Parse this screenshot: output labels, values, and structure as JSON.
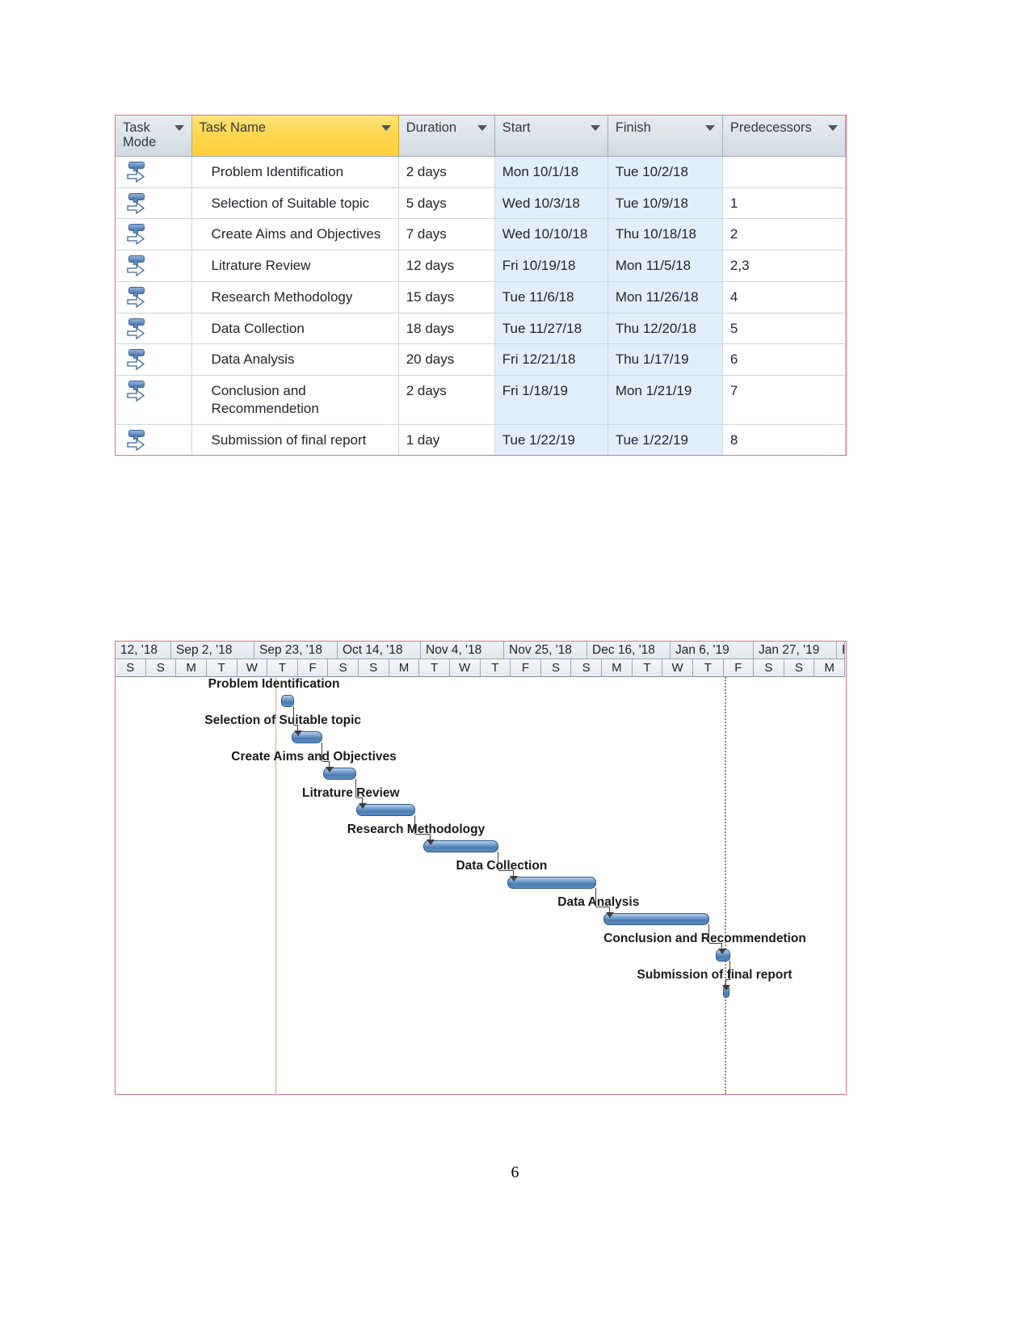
{
  "document": {
    "page_number": "6"
  },
  "task_table": {
    "columns": [
      {
        "key": "mode",
        "label": "Task Mode",
        "highlight": false,
        "has_filter_arrow": true
      },
      {
        "key": "name",
        "label": "Task Name",
        "highlight": true,
        "has_filter_arrow": true
      },
      {
        "key": "duration",
        "label": "Duration",
        "highlight": false,
        "has_filter_arrow": true
      },
      {
        "key": "start",
        "label": "Start",
        "highlight": false,
        "has_filter_arrow": true
      },
      {
        "key": "finish",
        "label": "Finish",
        "highlight": false,
        "has_filter_arrow": true
      },
      {
        "key": "predecessors",
        "label": "Predecessors",
        "highlight": false,
        "has_filter_arrow": true
      }
    ],
    "rows": [
      {
        "id": 1,
        "mode_icon": "auto-schedule-icon",
        "name": "Problem Identification",
        "duration": "2 days",
        "start": "Mon 10/1/18",
        "finish": "Tue 10/2/18",
        "predecessors": ""
      },
      {
        "id": 2,
        "mode_icon": "auto-schedule-icon",
        "name": "Selection of Suitable topic",
        "duration": "5 days",
        "start": "Wed 10/3/18",
        "finish": "Tue 10/9/18",
        "predecessors": "1"
      },
      {
        "id": 3,
        "mode_icon": "auto-schedule-icon",
        "name": "Create Aims and Objectives",
        "duration": "7 days",
        "start": "Wed 10/10/18",
        "finish": "Thu 10/18/18",
        "predecessors": "2"
      },
      {
        "id": 4,
        "mode_icon": "auto-schedule-icon",
        "name": "Litrature Review",
        "duration": "12 days",
        "start": "Fri 10/19/18",
        "finish": "Mon 11/5/18",
        "predecessors": "2,3"
      },
      {
        "id": 5,
        "mode_icon": "auto-schedule-icon",
        "name": "Research Methodology",
        "duration": "15 days",
        "start": "Tue 11/6/18",
        "finish": "Mon 11/26/18",
        "predecessors": "4"
      },
      {
        "id": 6,
        "mode_icon": "auto-schedule-icon",
        "name": "Data Collection",
        "duration": "18 days",
        "start": "Tue 11/27/18",
        "finish": "Thu 12/20/18",
        "predecessors": "5"
      },
      {
        "id": 7,
        "mode_icon": "auto-schedule-icon",
        "name": "Data Analysis",
        "duration": "20 days",
        "start": "Fri 12/21/18",
        "finish": "Thu 1/17/19",
        "predecessors": "6"
      },
      {
        "id": 8,
        "mode_icon": "auto-schedule-icon",
        "name": "Conclusion and Recommendetion",
        "duration": "2 days",
        "start": "Fri 1/18/19",
        "finish": "Mon 1/21/19",
        "predecessors": "7"
      },
      {
        "id": 9,
        "mode_icon": "auto-schedule-icon",
        "name": "Submission of final report",
        "duration": "1 day",
        "start": "Tue 1/22/19",
        "finish": "Tue 1/22/19",
        "predecessors": "8"
      }
    ]
  },
  "gantt": {
    "timeline": {
      "week_labels": [
        "12, '18",
        "Sep 2, '18",
        "Sep 23, '18",
        "Oct 14, '18",
        "Nov 4, '18",
        "Nov 25, '18",
        "Dec 16, '18",
        "Jan 6, '19",
        "Jan 27, '19",
        "Feb"
      ],
      "day_labels": [
        "S",
        "S",
        "M",
        "T",
        "W",
        "T",
        "F",
        "S",
        "S",
        "M",
        "T",
        "W",
        "T",
        "F",
        "S",
        "S",
        "M",
        "T",
        "W",
        "T",
        "F",
        "S",
        "S",
        "M"
      ]
    },
    "bars": [
      {
        "task": "Problem Identification",
        "label": "Problem Identification",
        "left_pct": 22.7,
        "width_pct": 1.7,
        "row": 0
      },
      {
        "task": "Selection of Suitable topic",
        "label": "Selection of Suitable topic",
        "left_pct": 24.1,
        "width_pct": 4.2,
        "row": 1
      },
      {
        "task": "Create Aims and Objectives",
        "label": "Create Aims and Objectives",
        "left_pct": 28.4,
        "width_pct": 4.6,
        "row": 2
      },
      {
        "task": "Litrature Review",
        "label": "Litrature Review",
        "left_pct": 33.0,
        "width_pct": 8.0,
        "row": 3
      },
      {
        "task": "Research Methodology",
        "label": "Research Methodology",
        "left_pct": 42.2,
        "width_pct": 10.2,
        "row": 4
      },
      {
        "task": "Data Collection",
        "label": "Data Collection",
        "left_pct": 53.6,
        "width_pct": 12.2,
        "row": 5
      },
      {
        "task": "Data Analysis",
        "label": "Data Analysis",
        "left_pct": 66.8,
        "width_pct": 14.5,
        "row": 6
      },
      {
        "task": "Conclusion and Recommendetion",
        "label": "Conclusion and Recommendetion",
        "left_pct": 82.2,
        "width_pct": 2.0,
        "row": 7
      },
      {
        "task": "Submission of final report",
        "label": "Submission of final report",
        "left_pct": 83.2,
        "width_pct": 0.9,
        "row": 8
      }
    ],
    "markers": {
      "project_start_line_pct": 21.9,
      "status_line_pct": 83.4
    },
    "colors": {
      "bar_fill": "#4b7db3",
      "bar_border": "#2f5a88",
      "header_highlight": "#ffd64f",
      "cell_tint": "#e3eefb",
      "frame_border": "#e0727b",
      "today_line": "#d8a868"
    }
  }
}
